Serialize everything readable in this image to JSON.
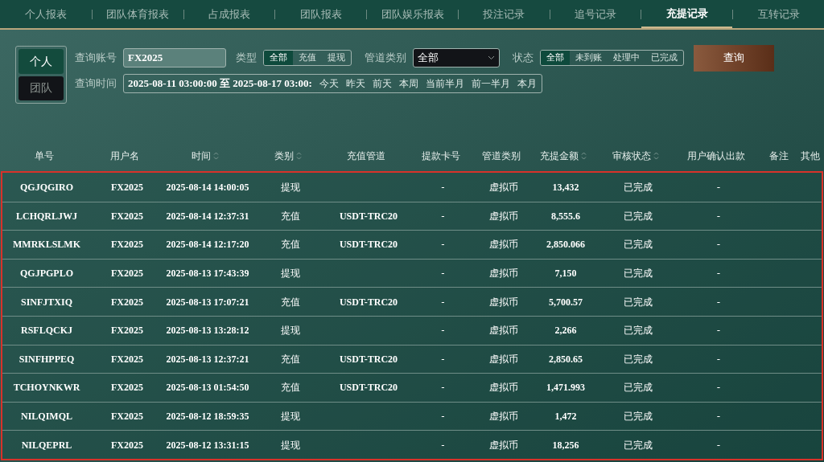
{
  "tabs": [
    {
      "label": "个人报表",
      "selected": false
    },
    {
      "label": "团队体育报表",
      "selected": false
    },
    {
      "label": "占成报表",
      "selected": false
    },
    {
      "label": "团队报表",
      "selected": false
    },
    {
      "label": "团队娱乐报表",
      "selected": false
    },
    {
      "label": "投注记录",
      "selected": false
    },
    {
      "label": "追号记录",
      "selected": false
    },
    {
      "label": "充提记录",
      "selected": true
    },
    {
      "label": "互转记录",
      "selected": false
    }
  ],
  "scope": [
    {
      "label": "个人",
      "selected": true
    },
    {
      "label": "团队",
      "selected": false
    }
  ],
  "filters": {
    "account_label": "查询账号",
    "account_value": "FX2025",
    "type_label": "类型",
    "type_options": [
      {
        "label": "全部",
        "selected": true
      },
      {
        "label": "充值",
        "selected": false
      },
      {
        "label": "提现",
        "selected": false
      }
    ],
    "channel_label": "管道类别",
    "channel_value": "全部",
    "status_label": "状态",
    "status_options": [
      {
        "label": "全部",
        "selected": true
      },
      {
        "label": "未到账",
        "selected": false
      },
      {
        "label": "处理中",
        "selected": false
      },
      {
        "label": "已完成",
        "selected": false
      }
    ],
    "search_button": "查询",
    "time_label": "查询时间",
    "time_value": "2025-08-11 03:00:00 至 2025-08-17 03:00:",
    "quick_ranges": [
      "今天",
      "昨天",
      "前天",
      "本周",
      "当前半月",
      "前一半月",
      "本月"
    ]
  },
  "table": {
    "columns": [
      {
        "label": "单号",
        "sortable": false
      },
      {
        "label": "用户名",
        "sortable": false
      },
      {
        "label": "时间",
        "sortable": true
      },
      {
        "label": "类别",
        "sortable": true
      },
      {
        "label": "充值管道",
        "sortable": false
      },
      {
        "label": "提款卡号",
        "sortable": false
      },
      {
        "label": "管道类别",
        "sortable": false
      },
      {
        "label": "充提金额",
        "sortable": true
      },
      {
        "label": "审核状态",
        "sortable": true
      },
      {
        "label": "用户确认出款",
        "sortable": false
      },
      {
        "label": "备注",
        "sortable": false
      },
      {
        "label": "其他",
        "sortable": false
      }
    ],
    "rows": [
      [
        "QGJQGIRO",
        "FX2025",
        "2025-08-14 14:00:05",
        "提现",
        "",
        "-",
        "虚拟币",
        "13,432",
        "已完成",
        "-",
        "",
        ""
      ],
      [
        "LCHQRLJWJ",
        "FX2025",
        "2025-08-14 12:37:31",
        "充值",
        "USDT-TRC20",
        "-",
        "虚拟币",
        "8,555.6",
        "已完成",
        "-",
        "",
        ""
      ],
      [
        "MMRKLSLMK",
        "FX2025",
        "2025-08-14 12:17:20",
        "充值",
        "USDT-TRC20",
        "-",
        "虚拟币",
        "2,850.066",
        "已完成",
        "-",
        "",
        ""
      ],
      [
        "QGJPGPLO",
        "FX2025",
        "2025-08-13 17:43:39",
        "提现",
        "",
        "-",
        "虚拟币",
        "7,150",
        "已完成",
        "-",
        "",
        ""
      ],
      [
        "SINFJTXIQ",
        "FX2025",
        "2025-08-13 17:07:21",
        "充值",
        "USDT-TRC20",
        "-",
        "虚拟币",
        "5,700.57",
        "已完成",
        "-",
        "",
        ""
      ],
      [
        "RSFLQCKJ",
        "FX2025",
        "2025-08-13 13:28:12",
        "提现",
        "",
        "-",
        "虚拟币",
        "2,266",
        "已完成",
        "-",
        "",
        ""
      ],
      [
        "SINFHPPEQ",
        "FX2025",
        "2025-08-13 12:37:21",
        "充值",
        "USDT-TRC20",
        "-",
        "虚拟币",
        "2,850.65",
        "已完成",
        "-",
        "",
        ""
      ],
      [
        "TCHOYNKWR",
        "FX2025",
        "2025-08-13 01:54:50",
        "充值",
        "USDT-TRC20",
        "-",
        "虚拟币",
        "1,471.993",
        "已完成",
        "-",
        "",
        ""
      ],
      [
        "NILQIMQL",
        "FX2025",
        "2025-08-12 18:59:35",
        "提现",
        "",
        "-",
        "虚拟币",
        "1,472",
        "已完成",
        "-",
        "",
        ""
      ],
      [
        "NILQEPRL",
        "FX2025",
        "2025-08-12 13:31:15",
        "提现",
        "",
        "-",
        "虚拟币",
        "18,256",
        "已完成",
        "-",
        "",
        ""
      ]
    ]
  }
}
